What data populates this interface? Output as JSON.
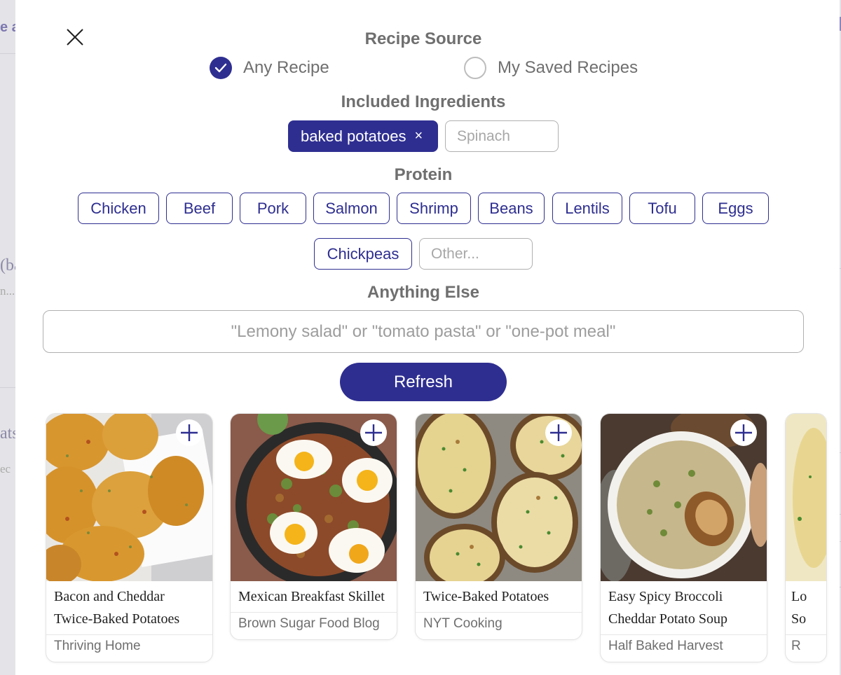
{
  "background": {
    "frag1": "e a",
    "frag2": "(ba",
    "frag3": "n...",
    "frag4": "ats",
    "frag5": "ec"
  },
  "close_icon": "close-icon",
  "recipe_source": {
    "title": "Recipe Source",
    "options": [
      {
        "label": "Any Recipe",
        "checked": true
      },
      {
        "label": "My Saved Recipes",
        "checked": false
      }
    ]
  },
  "ingredients": {
    "title": "Included Ingredients",
    "selected": [
      "baked potatoes"
    ],
    "remove_symbol": "×",
    "input_placeholder": "Spinach"
  },
  "protein": {
    "title": "Protein",
    "options": [
      "Chicken",
      "Beef",
      "Pork",
      "Salmon",
      "Shrimp",
      "Beans",
      "Lentils",
      "Tofu",
      "Eggs",
      "Chickpeas"
    ],
    "other_placeholder": "Other..."
  },
  "anything_else": {
    "title": "Anything Else",
    "placeholder": "\"Lemony salad\" or \"tomato pasta\" or \"one-pot meal\""
  },
  "refresh_label": "Refresh",
  "recipes": [
    {
      "title": "Bacon and Cheddar Twice-Baked Potatoes",
      "source": "Thriving Home"
    },
    {
      "title": "Mexican Breakfast Skillet",
      "source": "Brown Sugar Food Blog"
    },
    {
      "title": "Twice-Baked Potatoes",
      "source": "NYT Cooking"
    },
    {
      "title": "Easy Spicy Broccoli Cheddar Potato Soup",
      "source": "Half Baked Harvest"
    },
    {
      "title": "Lo...",
      "source": "R"
    }
  ],
  "partial_card": {
    "title_line1": "Lo",
    "title_line2": "So",
    "source": "R"
  },
  "colors": {
    "accent": "#2e2e91",
    "muted_text": "#6f6f6f",
    "border": "#b0b0b0"
  }
}
